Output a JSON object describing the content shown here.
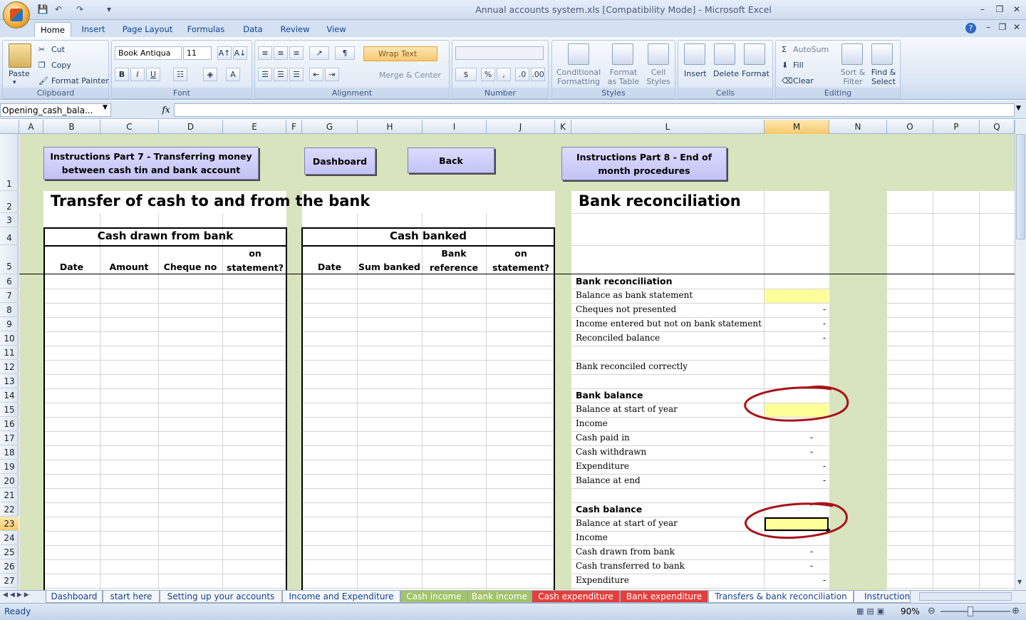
{
  "window": {
    "title": "Annual accounts system.xls  [Compatibility Mode] - Microsoft Excel"
  },
  "ribbon": {
    "tabs": [
      "Home",
      "Insert",
      "Page Layout",
      "Formulas",
      "Data",
      "Review",
      "View"
    ],
    "active_tab": "Home",
    "clipboard": {
      "paste": "Paste",
      "cut": "Cut",
      "copy": "Copy",
      "format_painter": "Format Painter",
      "label": "Clipboard"
    },
    "font": {
      "name": "Book Antiqua",
      "size": "11",
      "label": "Font"
    },
    "alignment": {
      "wrap_text": "Wrap Text",
      "merge_center": "Merge & Center",
      "label": "Alignment"
    },
    "number": {
      "label": "Number"
    },
    "styles": {
      "conditional_formatting": "Conditional Formatting",
      "format_as_table": "Format as Table",
      "cell_styles": "Cell Styles",
      "label": "Styles"
    },
    "cells": {
      "insert": "Insert",
      "delete": "Delete",
      "format": "Format",
      "label": "Cells"
    },
    "editing": {
      "autosum": "AutoSum",
      "fill": "Fill",
      "clear": "Clear",
      "sort_filter": "Sort & Filter",
      "find_select": "Find & Select",
      "label": "Editing"
    }
  },
  "formula_bar": {
    "name_box": "Opening_cash_bala...",
    "fx": "fx",
    "value": ""
  },
  "columns": [
    "A",
    "B",
    "C",
    "D",
    "E",
    "F",
    "G",
    "H",
    "I",
    "J",
    "K",
    "L",
    "M",
    "N",
    "O",
    "P",
    "Q"
  ],
  "selected_column": "M",
  "rows": [
    "1",
    "2",
    "3",
    "4",
    "5",
    "6",
    "7",
    "8",
    "9",
    "10",
    "11",
    "12",
    "13",
    "14",
    "15",
    "16",
    "17",
    "18",
    "19",
    "20",
    "21",
    "22",
    "23",
    "24",
    "25",
    "26",
    "27"
  ],
  "selected_row": "23",
  "buttons": {
    "instr7": "Instructions Part 7 - Transferring money between cash tin and bank account",
    "dashboard": "Dashboard",
    "back": "Back",
    "instr8": "Instructions Part 8 - End of month procedures"
  },
  "left_title": "Transfer of cash to and from the bank",
  "cash_drawn": {
    "title": "Cash drawn from bank",
    "headers": [
      "Date",
      "Amount",
      "Cheque no",
      "on statement?"
    ]
  },
  "cash_banked": {
    "title": "Cash banked",
    "headers": [
      "Date",
      "Sum banked",
      "Bank reference",
      "on statement?"
    ]
  },
  "bank_rec": {
    "title": "Bank reconciliation",
    "section1": "Bank reconciliation",
    "balance_as_statement": "Balance as bank statement",
    "cheques_not_presented": "Cheques not presented",
    "income_not_on_statement": "Income entered but not on bank statement",
    "reconciled_balance": "Reconciled balance",
    "reconciled_correctly": "Bank reconciled correctly",
    "section2": "Bank balance",
    "bb_start": "Balance at start of year",
    "bb_income": "Income",
    "bb_cash_paid_in": "Cash paid in",
    "bb_cash_withdrawn": "Cash withdrawn",
    "bb_expenditure": "Expenditure",
    "bb_end": "Balance at end",
    "section3": "Cash balance",
    "cb_start": "Balance at start of year",
    "cb_income": "Income",
    "cb_drawn": "Cash drawn from bank",
    "cb_transferred": "Cash transferred to bank",
    "cb_expenditure": "Expenditure",
    "dash": "-"
  },
  "sheet_tabs": [
    "Dashboard",
    "start here",
    "Setting up your accounts",
    "Income and Expenditure",
    "Cash income",
    "Bank income",
    "Cash expenditure",
    "Bank expenditure",
    "Transfers & bank reconciliation",
    "Instruction"
  ],
  "active_sheet": "Transfers & bank reconciliation",
  "status": {
    "ready": "Ready",
    "zoom": "90%"
  }
}
